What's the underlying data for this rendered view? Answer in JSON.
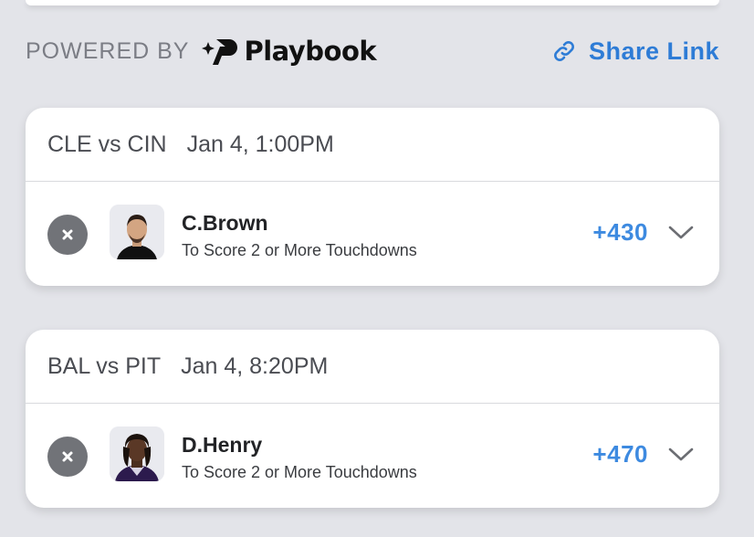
{
  "header": {
    "powered_by": "POWERED BY",
    "brand_name": "Playbook",
    "share_label": "Share Link",
    "accent_color": "#2e7cd6"
  },
  "bets": [
    {
      "matchup": "CLE vs CIN",
      "datetime": "Jan 4, 1:00PM",
      "player": "C.Brown",
      "market": "To Score 2 or More Touchdowns",
      "odds": "+430"
    },
    {
      "matchup": "BAL vs PIT",
      "datetime": "Jan 4, 8:20PM",
      "player": "D.Henry",
      "market": "To Score 2 or More Touchdowns",
      "odds": "+470"
    }
  ],
  "icons": {
    "logo": "playbook-logo-icon",
    "share": "link-icon",
    "remove": "close-icon",
    "expand": "chevron-down-icon"
  },
  "colors": {
    "odds": "#3d8ae0",
    "background": "#e3e4e9"
  }
}
